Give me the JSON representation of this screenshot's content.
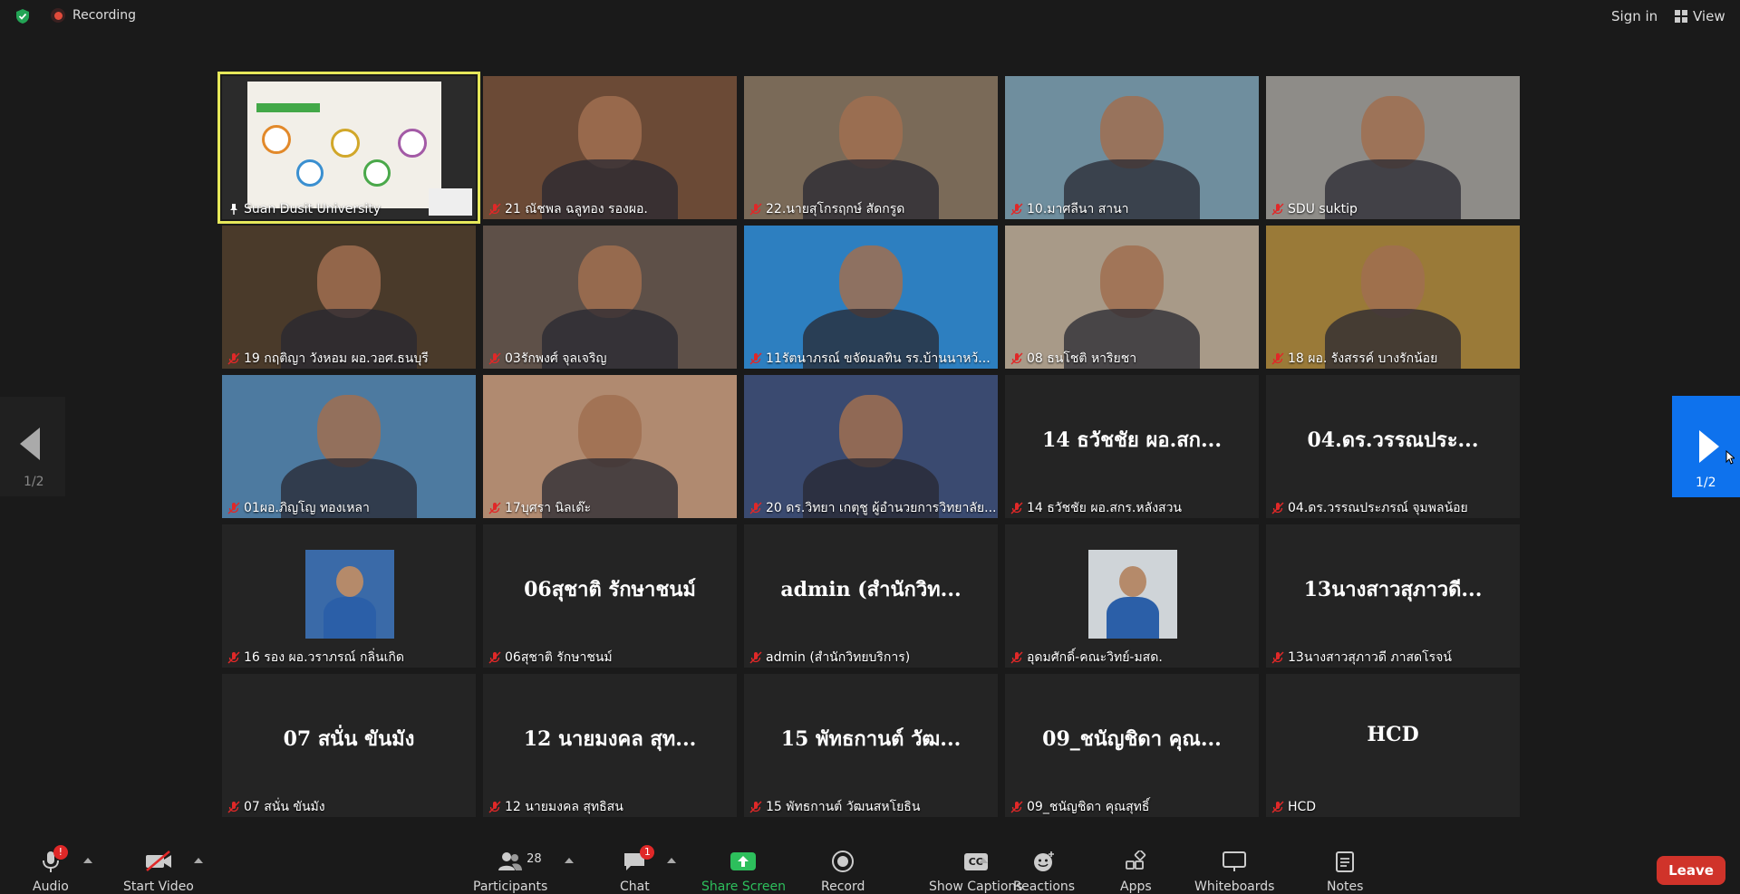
{
  "topbar": {
    "recording_label": "Recording",
    "signin_label": "Sign in",
    "view_label": "View"
  },
  "tiles": [
    {
      "name": "Suan Dusit University",
      "kind": "screen"
    },
    {
      "name": "21 ณัชพล ฉลูทอง รองผอ.",
      "kind": "video",
      "bg": "#6b4a36"
    },
    {
      "name": "22.นายสุโกรฤกษ์ สัดกรูด",
      "kind": "video",
      "bg": "#7a6a58"
    },
    {
      "name": "10.มาศลีนา สานา",
      "kind": "video",
      "bg": "#6f8e9e"
    },
    {
      "name": "SDU suktip",
      "kind": "video",
      "bg": "#8e8c88"
    },
    {
      "name": "19 กฤติญา วังหอม ผอ.วอศ.ธนบุรี",
      "kind": "video",
      "bg": "#4a3a2a"
    },
    {
      "name": "03รักพงศ์ จุลเจริญ",
      "kind": "video",
      "bg": "#5e5048"
    },
    {
      "name": "11รัตนาภรณ์ ขจัดมลทิน รร.บ้านนาหว้...",
      "kind": "video",
      "bg": "#2d7fc0"
    },
    {
      "name": "08 ธนโชติ หาริยชา",
      "kind": "video",
      "bg": "#a89a88"
    },
    {
      "name": "18 ผอ. รังสรรค์ บางรักน้อย",
      "kind": "video",
      "bg": "#9a7a38"
    },
    {
      "name": "01ผอ.ภิญโญ ทองเหลา",
      "kind": "video",
      "bg": "#4d7aa0"
    },
    {
      "name": "17บุศรา นิลเด๊ะ",
      "kind": "video",
      "bg": "#b08a70"
    },
    {
      "name": "20 ดร.วิทยา เกตุชู ผู้อำนวยการวิทยาลัย...",
      "kind": "video",
      "bg": "#3a4a70"
    },
    {
      "name": "14 ธวัชชัย ผอ.สกร.หลังสวน",
      "kind": "name",
      "display": "14 ธวัชชัย ผอ.สก..."
    },
    {
      "name": "04.ดร.วรรณประภรณ์ จุมพลน้อย",
      "kind": "name",
      "display": "04.ดร.วรรณประ..."
    },
    {
      "name": "16 รอง ผอ.วราภรณ์ กลิ่นเกิด",
      "kind": "avatar",
      "bg": "#3a6aa8"
    },
    {
      "name": "06สุชาติ รักษาชนม์",
      "kind": "name",
      "display": "06สุชาติ รักษาชนม์"
    },
    {
      "name": "admin (สำนักวิทยบริการ)",
      "kind": "name",
      "display": "admin (สำนักวิท..."
    },
    {
      "name": "อุดมศักดิ์-คณะวิทย์-มสด.",
      "kind": "avatar",
      "bg": "#cfd4d8"
    },
    {
      "name": "13นางสาวสุภาวดี ภาสดโรจน์",
      "kind": "name",
      "display": "13นางสาวสุภาวดี..."
    },
    {
      "name": "07 สนั่น ขันมัง",
      "kind": "name",
      "display": "07 สนั่น ขันมัง"
    },
    {
      "name": "12 นายมงคล สุทธิสน",
      "kind": "name",
      "display": "12 นายมงคล สุท..."
    },
    {
      "name": "15 พัทธกานต์ วัฒนสหโยธิน",
      "kind": "name",
      "display": "15 พัทธกานต์ วัฒ..."
    },
    {
      "name": "09_ชนัญชิดา คุณสุทธิ์",
      "kind": "name",
      "display": "09_ชนัญชิดา คุณ..."
    },
    {
      "name": "HCD",
      "kind": "name",
      "display": "HCD"
    }
  ],
  "pagination": {
    "left_page": "1/2",
    "right_page": "1/2"
  },
  "toolbar": {
    "audio": "Audio",
    "audio_badge": "!",
    "start_video": "Start Video",
    "participants": "Participants",
    "participants_count": "28",
    "chat": "Chat",
    "chat_badge": "1",
    "share_screen": "Share Screen",
    "record": "Record",
    "show_captions": "Show Captions",
    "captions_icon_text": "CC",
    "reactions": "Reactions",
    "apps": "Apps",
    "whiteboards": "Whiteboards",
    "notes": "Notes",
    "leave": "Leave"
  },
  "colors": {
    "share_green": "#2dbf5c",
    "leave_red": "#d0332a",
    "page_blue": "#0e72ed",
    "active_outline": "#e6e85a"
  }
}
